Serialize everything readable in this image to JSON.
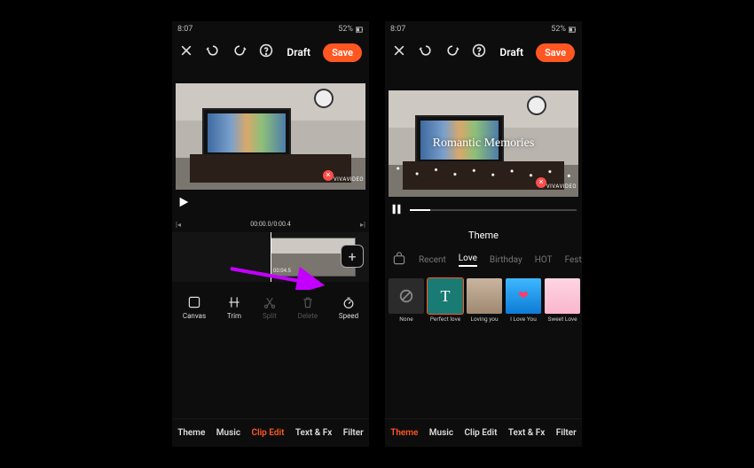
{
  "status": {
    "time": "8:07",
    "battery": "52%",
    "icons_left": "▧ ⓒ ⊙ •",
    "icons_right": "⌖ ⁂ ⁑ ᯤ ⊿"
  },
  "topbar": {
    "draft": "Draft",
    "save": "Save"
  },
  "left": {
    "watermark": "VIVAVIDEO",
    "time_center": "00:00.0/0:00.4",
    "clip_timestamp": "00:04.5",
    "tools": {
      "canvas": "Canvas",
      "trim": "Trim",
      "split": "Split",
      "delete": "Delete",
      "speed": "Speed"
    },
    "tabs": {
      "theme": "Theme",
      "music": "Music",
      "clipedit": "Clip Edit",
      "textfx": "Text & Fx",
      "filter": "Filter"
    }
  },
  "right": {
    "overlay_title": "Romantic Memories",
    "watermark": "VIVAVIDEO",
    "panel_title": "Theme",
    "categories": {
      "recent": "Recent",
      "love": "Love",
      "birthday": "Birthday",
      "hot": "HOT",
      "festival": "Festi"
    },
    "thumbs": {
      "none": "None",
      "perfect": "Perfect love",
      "loving": "Loving you",
      "iloveyou": "I Love You",
      "sweet": "Sweet Love"
    },
    "tabs": {
      "theme": "Theme",
      "music": "Music",
      "clipedit": "Clip Edit",
      "textfx": "Text & Fx",
      "filter": "Filter"
    }
  }
}
